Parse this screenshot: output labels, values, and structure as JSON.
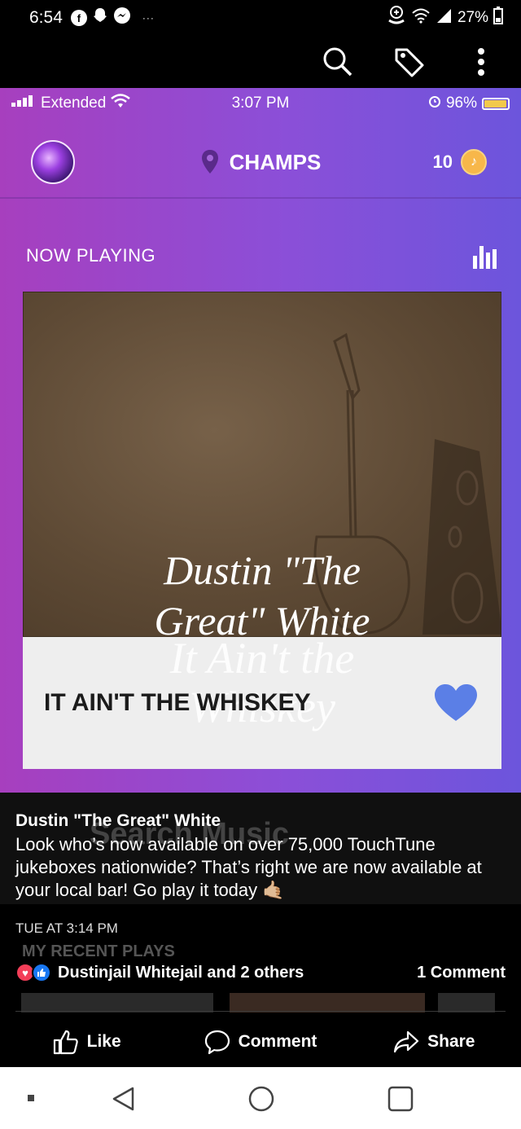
{
  "android_status": {
    "time": "6:54",
    "notifications": [
      "facebook-icon",
      "snapchat-icon",
      "messenger-icon"
    ],
    "more": "···",
    "battery": "27%"
  },
  "toolbar": {
    "icons": [
      "search-icon",
      "tag-icon",
      "more-options-icon"
    ]
  },
  "app": {
    "ios_status": {
      "carrier": "Extended",
      "time": "3:07 PM",
      "battery": "96%",
      "battery_level": 0.96
    },
    "header": {
      "venue": "CHAMPS",
      "credits": "10"
    },
    "now_playing_label": "NOW PLAYING",
    "album_art": {
      "line1": "Dustin \"The",
      "line2": "Great\" White",
      "line3": "It Ain't the",
      "line4": "Whiskey"
    },
    "song_title": "IT AIN'T THE WHISKEY",
    "colors": {
      "gradient_left": "#a73fbe",
      "gradient_right": "#6c55dc",
      "heart": "#5b7fe6"
    }
  },
  "caption": {
    "author": "Dustin \"The Great\" White",
    "body": "Look who’s now available on over 75,000 TouchTune jukeboxes nationwide? That’s right we are now available at your local bar! Go play it today 🤙🏼",
    "ghost_text": "Search Music"
  },
  "post": {
    "time": "TUE AT 3:14 PM",
    "ghost_recent": "MY RECENT PLAYS",
    "reactors": "Dustinjail Whitejail and 2 others",
    "comments": "1 Comment"
  },
  "actions": {
    "like": "Like",
    "comment": "Comment",
    "share": "Share"
  }
}
